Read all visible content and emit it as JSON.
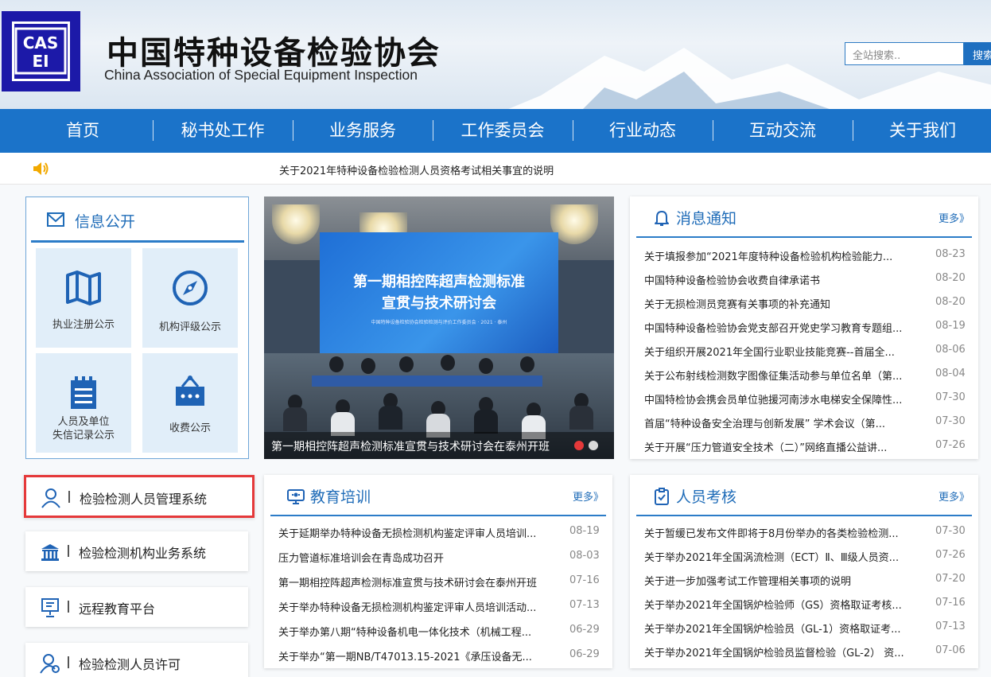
{
  "site": {
    "logo_text": "CASEI",
    "name_cn": "中国特种设备检验协会",
    "name_en": "China Association of Special Equipment Inspection"
  },
  "search": {
    "placeholder": "全站搜索..",
    "button": "搜索"
  },
  "nav": [
    "首页",
    "秘书处工作",
    "业务服务",
    "工作委员会",
    "行业动态",
    "互动交流",
    "关于我们"
  ],
  "notice": "关于2021年特种设备检验检测人员资格考试相关事宜的说明",
  "info": {
    "title": "信息公开",
    "tiles": [
      {
        "label": "执业注册公示",
        "icon": "map-icon"
      },
      {
        "label": "机构评级公示",
        "icon": "compass-icon"
      },
      {
        "label": "人员及单位\n失信记录公示",
        "icon": "checklist-icon"
      },
      {
        "label": "收费公示",
        "icon": "fee-board-icon"
      }
    ]
  },
  "systems": [
    {
      "label": "检验检测人员管理系统",
      "icon": "user-icon"
    },
    {
      "label": "检验检测机构业务系统",
      "icon": "institution-icon"
    },
    {
      "label": "远程教育平台",
      "icon": "presentation-icon"
    },
    {
      "label": "检验检测人员许可",
      "icon": "user-badge-icon"
    }
  ],
  "carousel": {
    "screen_title_1": "第一期相控阵超声检测标准",
    "screen_title_2": "宣贯与技术研讨会",
    "screen_sub": "中国特种设备检验协会检验检测与评价工作委员会 · 2021 · 泰州",
    "caption": "第一期相控阵超声检测标准宣贯与技术研讨会在泰州开班",
    "active_color": "#e5393a",
    "inactive_color": "#d9d9d9"
  },
  "notices_panel": {
    "title": "消息通知",
    "more": "更多》",
    "items": [
      {
        "title": "关于填报参加“2021年度特种设备检验机构检验能力...",
        "date": "08-23"
      },
      {
        "title": "中国特种设备检验协会收费自律承诺书",
        "date": "08-20"
      },
      {
        "title": "关于无损检测员竞赛有关事项的补充通知",
        "date": "08-20"
      },
      {
        "title": "中国特种设备检验协会党支部召开党史学习教育专题组...",
        "date": "08-19"
      },
      {
        "title": "关于组织开展2021年全国行业职业技能竞赛--首届全...",
        "date": "08-06"
      },
      {
        "title": "关于公布射线检测数字图像征集活动参与单位名单（第...",
        "date": "08-04"
      },
      {
        "title": "中国特检协会携会员单位驰援河南涉水电梯安全保障性...",
        "date": "07-30"
      },
      {
        "title": "首届“特种设备安全治理与创新发展” 学术会议（第...",
        "date": "07-30"
      },
      {
        "title": "关于开展“压力管道安全技术（二）”网络直播公益讲...",
        "date": "07-26"
      }
    ]
  },
  "training_panel": {
    "title": "教育培训",
    "more": "更多》",
    "items": [
      {
        "title": "关于延期举办特种设备无损检测机构鉴定评审人员培训...",
        "date": "08-19"
      },
      {
        "title": "压力管道标准培训会在青岛成功召开",
        "date": "08-03"
      },
      {
        "title": "第一期相控阵超声检测标准宣贯与技术研讨会在泰州开班",
        "date": "07-16"
      },
      {
        "title": "关于举办特种设备无损检测机构鉴定评审人员培训活动...",
        "date": "07-13"
      },
      {
        "title": "关于举办第八期“特种设备机电一体化技术（机械工程...",
        "date": "06-29"
      },
      {
        "title": "关于举办“第一期NB/T47013.15-2021《承压设备无...",
        "date": "06-29"
      }
    ]
  },
  "exam_panel": {
    "title": "人员考核",
    "more": "更多》",
    "items": [
      {
        "title": "关于暂缓已发布文件即将于8月份举办的各类检验检测...",
        "date": "07-30"
      },
      {
        "title": "关于举办2021年全国涡流检测（ECT）Ⅱ、Ⅲ级人员资...",
        "date": "07-26"
      },
      {
        "title": "关于进一步加强考试工作管理相关事项的说明",
        "date": "07-20"
      },
      {
        "title": "关于举办2021年全国锅炉检验师（GS）资格取证考核...",
        "date": "07-16"
      },
      {
        "title": "关于举办2021年全国锅炉检验员（GL-1）资格取证考...",
        "date": "07-13"
      },
      {
        "title": "关于举办2021年全国锅炉检验员监督检验（GL-2） 资...",
        "date": "07-06"
      }
    ]
  },
  "colors": {
    "brand_blue": "#1b73c9",
    "logo_blue": "#1c19a8",
    "highlight_red": "#e5393a"
  }
}
